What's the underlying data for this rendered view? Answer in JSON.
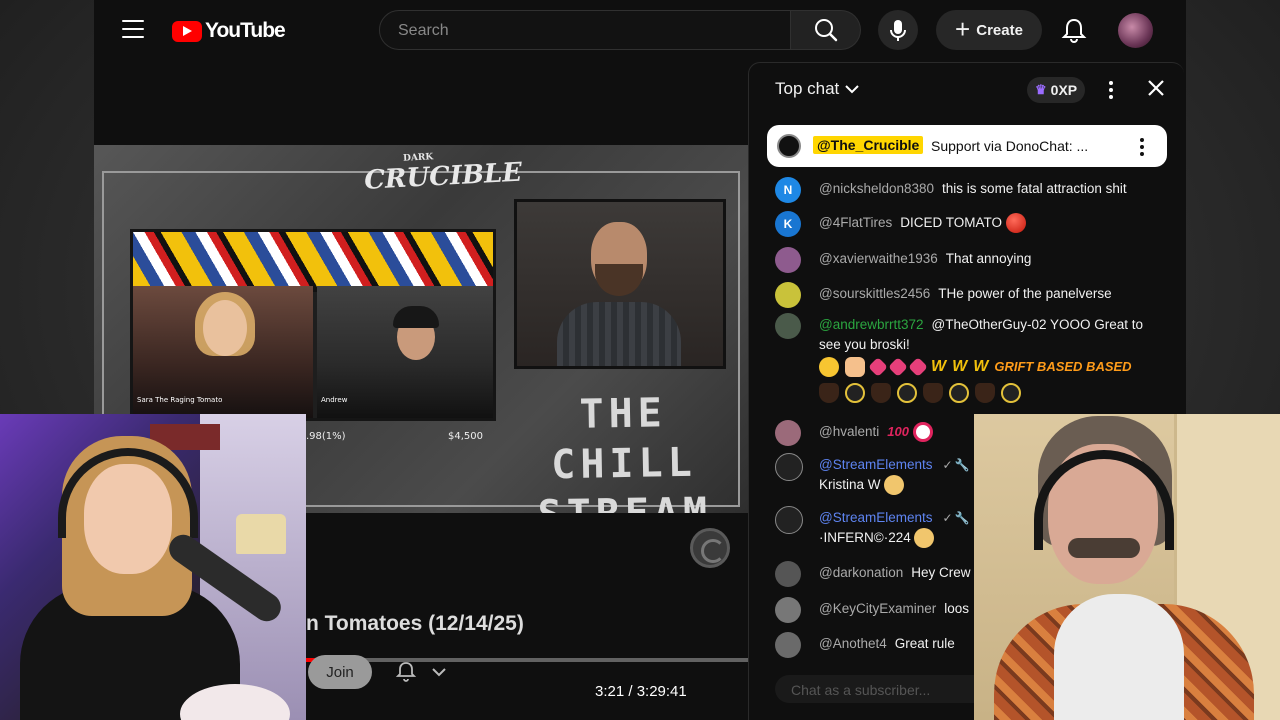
{
  "topbar": {
    "logo_text": "YouTube",
    "search_placeholder": "Search",
    "create_label": "Create"
  },
  "video": {
    "overlay_brand": "CRUCIBLE",
    "overlay_brand_small": "DARK",
    "stream_name_line1": "THE CHILL",
    "stream_name_line2": "STREAM",
    "cam_left_name": "Sara The Raging Tomato",
    "cam_right_name": "Andrew",
    "stat_left": ".98(1%)",
    "stat_right": "$4,500"
  },
  "video_meta": {
    "title": "n Tomatoes (12/14/25)",
    "join_label": "Join",
    "time_readout": "3:21 / 3:29:41",
    "progress_fraction": 0.016
  },
  "chat": {
    "mode_label": "Top chat",
    "xp_label": "0XP",
    "input_placeholder": "Chat as a subscriber...",
    "pinned": {
      "author": "@The_Crucible",
      "text": "Support via DonoChat: ..."
    },
    "messages": [
      {
        "author": "@nicksheldon8380",
        "text": "this is some fatal attraction shit",
        "avatar_letter": "N",
        "avatar_color": "#1e88e5"
      },
      {
        "author": "@4FlatTires",
        "text": "DICED TOMATO",
        "avatar_letter": "K",
        "avatar_color": "#1976d2"
      },
      {
        "author": "@xavierwaithe1936",
        "text": "That annoying",
        "avatar_letter": "",
        "avatar_color": "#8e5b8e"
      },
      {
        "author": "@sourskittles2456",
        "text": "THe power of the panelverse",
        "avatar_letter": "",
        "avatar_color": "#c9c23a"
      },
      {
        "author": "@andrewbrrtt372",
        "text": "@TheOtherGuy-02 YOOO Great to see you broski!",
        "avatar_letter": "",
        "avatar_color": "#4a5a4a",
        "emote_w": "W",
        "emote_grift": "GRIFT BASED BASED"
      },
      {
        "author": "@hvalenti",
        "text": "",
        "avatar_letter": "",
        "avatar_color": "#9b6a7a",
        "emote_100": "100"
      },
      {
        "author": "@StreamElements",
        "text": "Kristina W",
        "avatar_letter": "",
        "avatar_color": "#222"
      },
      {
        "author": "@StreamElements",
        "text": "·INFERN©·224",
        "avatar_letter": "",
        "avatar_color": "#222"
      },
      {
        "author": "@darkonation",
        "text": "Hey Crew",
        "avatar_letter": "",
        "avatar_color": "#555"
      },
      {
        "author": "@KeyCityExaminer",
        "text": "loos",
        "avatar_letter": "",
        "avatar_color": "#777"
      },
      {
        "author": "@Anothet4",
        "text": "Great rule",
        "avatar_letter": "",
        "avatar_color": "#6a6a6a"
      }
    ]
  },
  "colors": {
    "brand_red": "#ff0000",
    "pinned_highlight": "#ffd600",
    "moderator_blue": "#5e84f1",
    "member_green": "#2ba640"
  },
  "icons": [
    "menu-icon",
    "youtube-logo-icon",
    "search-icon",
    "mic-icon",
    "plus-icon",
    "bell-icon",
    "chevron-down-icon",
    "crown-icon",
    "more-vert-icon",
    "close-icon",
    "verified-check-icon",
    "wrench-icon"
  ]
}
